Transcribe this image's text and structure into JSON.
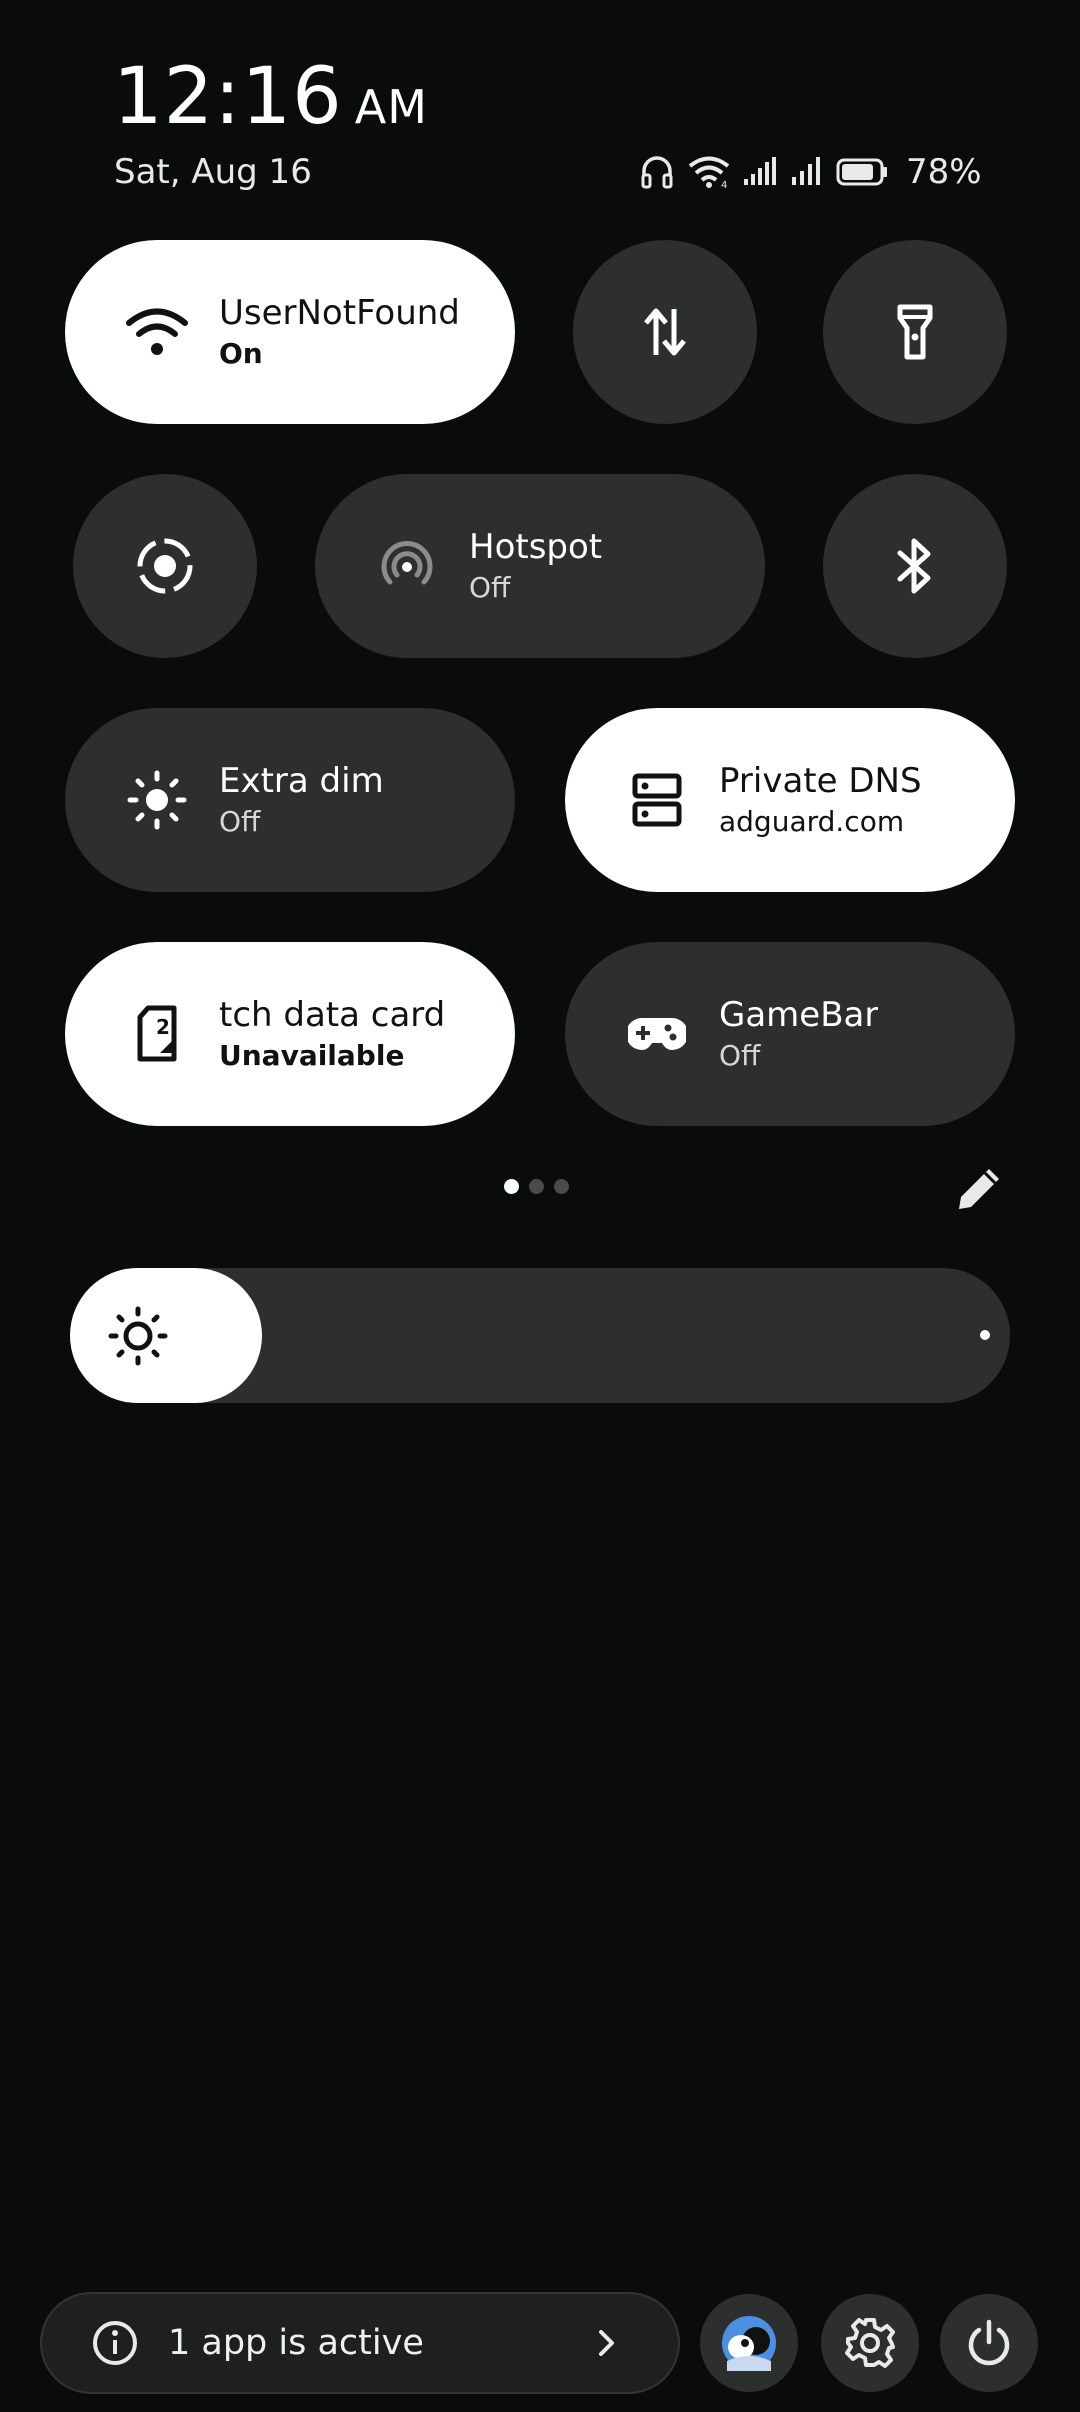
{
  "header": {
    "time": "12:16",
    "ampm": "AM",
    "date": "Sat, Aug 16",
    "battery_percent": "78%",
    "battery_level": 0.78,
    "status_icons": [
      "headphones-icon",
      "wifi-icon",
      "signal-icon",
      "signal-icon",
      "battery-icon"
    ]
  },
  "tiles": {
    "wifi": {
      "label": "UserNotFound",
      "sub": "On",
      "state": "on",
      "icon": "wifi-icon"
    },
    "data_transfer": {
      "icon": "data-arrows-icon",
      "state": "off"
    },
    "flashlight": {
      "icon": "flashlight-icon",
      "state": "off"
    },
    "screen_record": {
      "icon": "screen-record-icon",
      "state": "off"
    },
    "hotspot": {
      "label": "Hotspot",
      "sub": "Off",
      "state": "off",
      "icon": "hotspot-icon"
    },
    "bluetooth": {
      "icon": "bluetooth-icon",
      "state": "off"
    },
    "extra_dim": {
      "label": "Extra dim",
      "sub": "Off",
      "state": "off",
      "icon": "brightness-icon"
    },
    "private_dns": {
      "label": "Private DNS",
      "sub": "adguard.com",
      "state": "on",
      "icon": "dns-icon"
    },
    "switch_data": {
      "label": "tch data card",
      "sub": "Unavailable",
      "state": "on",
      "icon": "sim-2-icon"
    },
    "gamebar": {
      "label": "GameBar",
      "sub": "Off",
      "state": "off",
      "icon": "gamepad-icon"
    }
  },
  "pager": {
    "pages": 3,
    "current": 1
  },
  "brightness": {
    "level": 0.0,
    "icon": "brightness-icon"
  },
  "footer": {
    "active_apps_text": "1 app is active",
    "buttons": [
      "avatar",
      "settings-icon",
      "power-icon"
    ]
  },
  "colors": {
    "background": "#0a0b0b",
    "tile_on": "#ffffff",
    "tile_off": "#2d2e2e"
  }
}
